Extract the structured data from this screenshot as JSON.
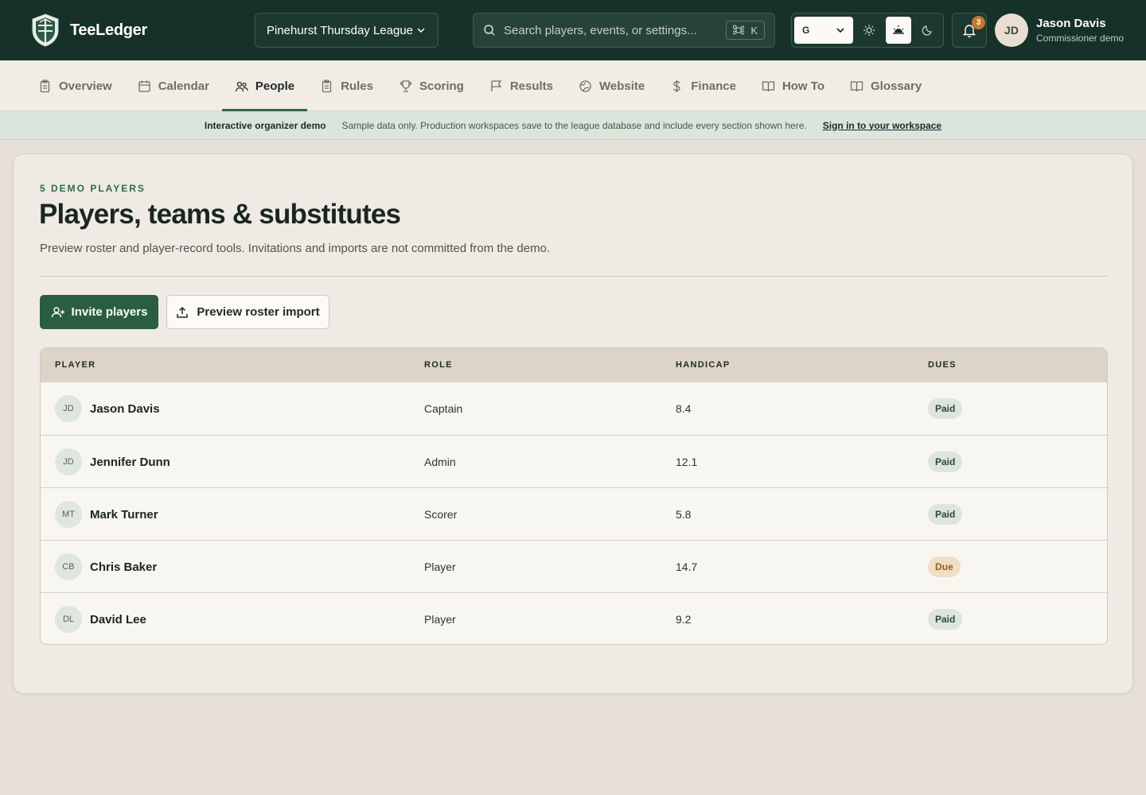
{
  "app": {
    "name": "TeeLedger",
    "league": "Pinehurst Thursday League",
    "search_placeholder": "Search players, events, or settings...",
    "search_shortcut_key": "K",
    "language": "G",
    "notification_count": "3",
    "user": {
      "initials": "JD",
      "name": "Jason Davis",
      "role": "Commissioner demo"
    }
  },
  "nav": {
    "tabs": [
      {
        "label": "Overview",
        "icon": "clipboard-icon",
        "active": false
      },
      {
        "label": "Calendar",
        "icon": "calendar-icon",
        "active": false
      },
      {
        "label": "People",
        "icon": "people-icon",
        "active": true
      },
      {
        "label": "Rules",
        "icon": "clipboard-icon",
        "active": false
      },
      {
        "label": "Scoring",
        "icon": "trophy-icon",
        "active": false
      },
      {
        "label": "Results",
        "icon": "flag-icon",
        "active": false
      },
      {
        "label": "Website",
        "icon": "globe-icon",
        "active": false
      },
      {
        "label": "Finance",
        "icon": "dollar-icon",
        "active": false
      },
      {
        "label": "How To",
        "icon": "book-icon",
        "active": false
      },
      {
        "label": "Glossary",
        "icon": "book-icon",
        "active": false
      }
    ]
  },
  "banner": {
    "title": "Interactive organizer demo",
    "text": "Sample data only. Production workspaces save to the league database and include every section shown here.",
    "link": "Sign in to your workspace"
  },
  "page": {
    "eyebrow": "5 DEMO PLAYERS",
    "title": "Players, teams & substitutes",
    "description": "Preview roster and player-record tools. Invitations and imports are not committed from the demo.",
    "invite_label": "Invite players",
    "import_label": "Preview roster import"
  },
  "table": {
    "headers": {
      "player": "PLAYER",
      "role": "ROLE",
      "handicap": "HANDICAP",
      "dues": "DUES"
    },
    "rows": [
      {
        "initials": "JD",
        "name": "Jason Davis",
        "role": "Captain",
        "handicap": "8.4",
        "dues": "Paid"
      },
      {
        "initials": "JD",
        "name": "Jennifer Dunn",
        "role": "Admin",
        "handicap": "12.1",
        "dues": "Paid"
      },
      {
        "initials": "MT",
        "name": "Mark Turner",
        "role": "Scorer",
        "handicap": "5.8",
        "dues": "Paid"
      },
      {
        "initials": "CB",
        "name": "Chris Baker",
        "role": "Player",
        "handicap": "14.7",
        "dues": "Due"
      },
      {
        "initials": "DL",
        "name": "David Lee",
        "role": "Player",
        "handicap": "9.2",
        "dues": "Paid"
      }
    ]
  },
  "colors": {
    "header_bg": "#16302a",
    "accent_green": "#2a5e40",
    "paid_badge": "#dde5dc",
    "due_badge": "#f0dec6",
    "notification": "#c7762c"
  }
}
